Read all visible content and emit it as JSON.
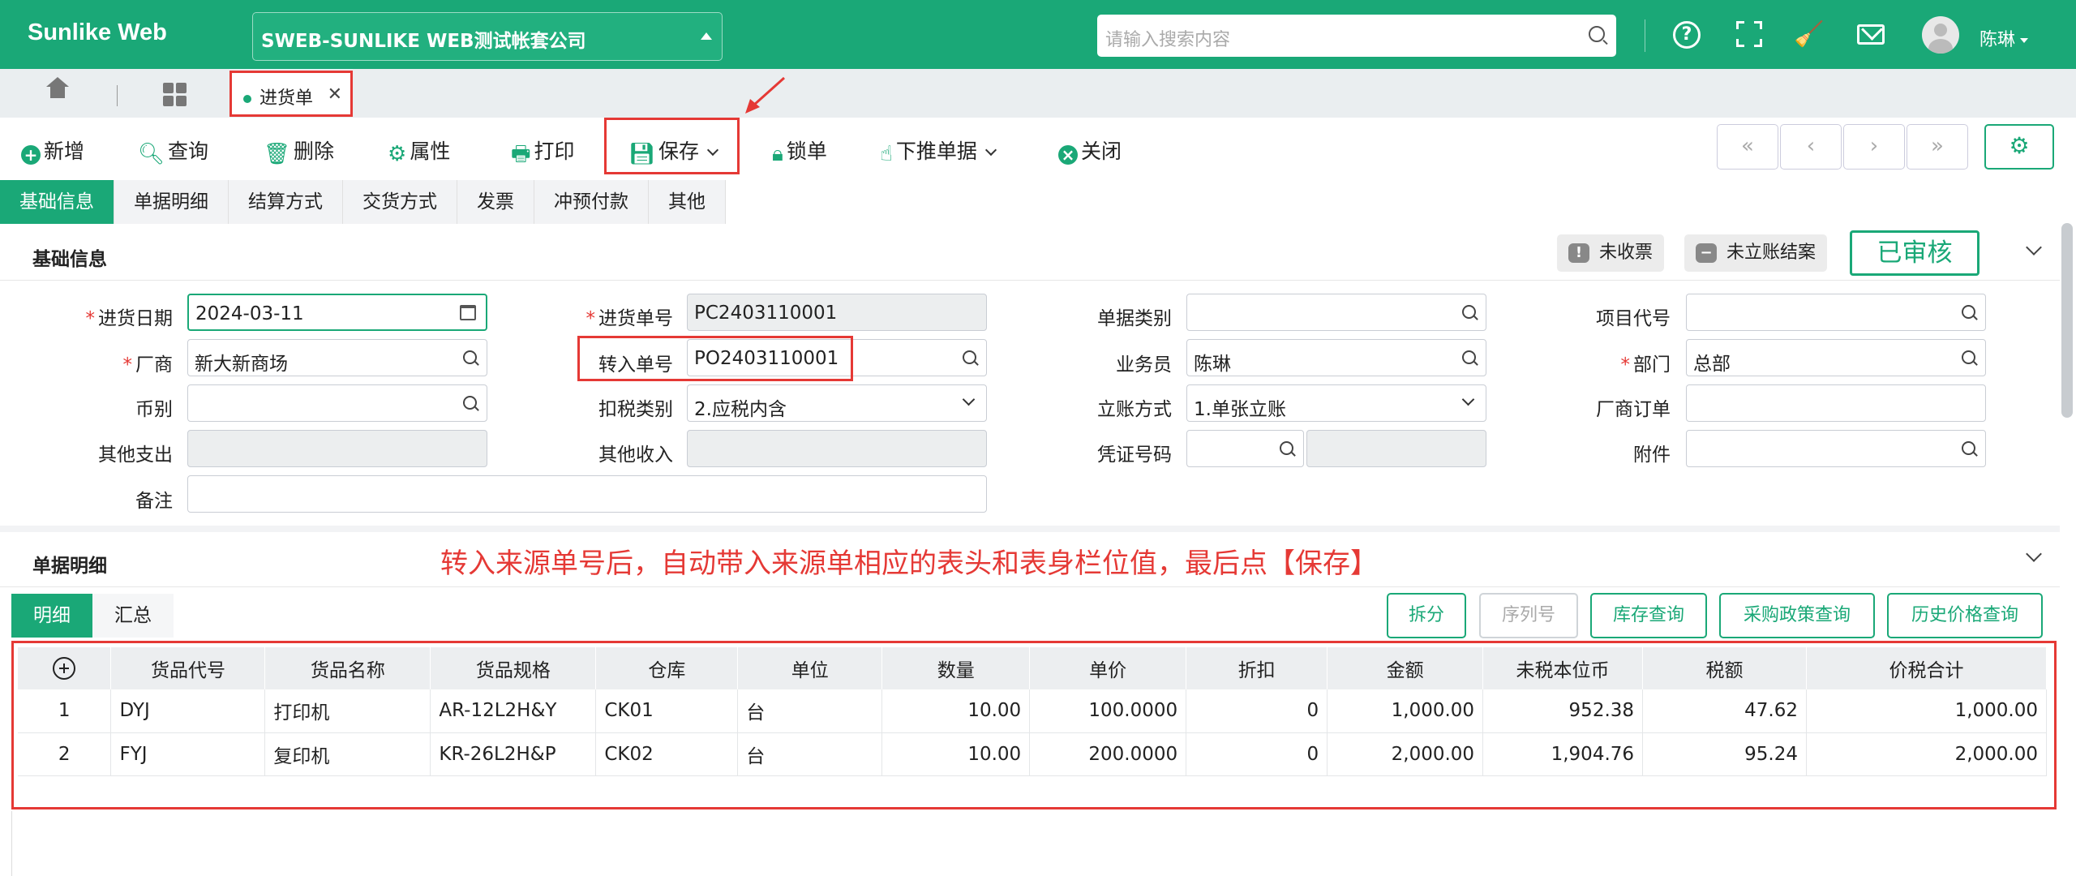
{
  "topbar": {
    "logo": "Sunlike Web",
    "company": "SWEB-SUNLIKE WEB测试帐套公司",
    "search_placeholder": "请输入搜索内容",
    "user": "陈琳",
    "colors": {
      "brand": "#1aa877",
      "alert": "#e53935"
    }
  },
  "tabs": {
    "doc_tab": "进货单"
  },
  "toolbar": {
    "new": "新增",
    "query": "查询",
    "delete": "删除",
    "props": "属性",
    "print": "打印",
    "save": "保存",
    "lock": "锁单",
    "push": "下推单据",
    "close": "关闭"
  },
  "subtabs": [
    "基础信息",
    "单据明细",
    "结算方式",
    "交货方式",
    "发票",
    "冲预付款",
    "其他"
  ],
  "basic": {
    "title": "基础信息",
    "badges": {
      "invoice": "未收票",
      "account": "未立账结案",
      "status": "已审核"
    }
  },
  "form": {
    "date_label": "进货日期",
    "date": "2024-03-11",
    "vendor_label": "厂商",
    "vendor": "新大新商场",
    "currency_label": "币别",
    "currency": "",
    "other_exp_label": "其他支出",
    "remark_label": "备注",
    "bill_no_label": "进货单号",
    "bill_no": "PC2403110001",
    "src_no_label": "转入单号",
    "src_no": "PO2403110001",
    "tax_label": "扣税类别",
    "tax": "2.应税内含",
    "other_inc_label": "其他收入",
    "bill_type_label": "单据类别",
    "bill_type": "",
    "clerk_label": "业务员",
    "clerk": "陈琳",
    "acct_label": "立账方式",
    "acct": "1.单张立账",
    "voucher_label": "凭证号码",
    "project_label": "项目代号",
    "dept_label": "部门",
    "dept": "总部",
    "vendor_order_label": "厂商订单",
    "attach_label": "附件"
  },
  "detail": {
    "title": "单据明细",
    "annotation": "转入来源单号后，自动带入来源单相应的表头和表身栏位值，最后点【保存】",
    "tabs": [
      "明细",
      "汇总"
    ],
    "buttons": {
      "split": "拆分",
      "serial": "序列号",
      "stock": "库存查询",
      "policy": "采购政策查询",
      "history": "历史价格查询"
    },
    "columns": [
      "货品代号",
      "货品名称",
      "货品规格",
      "仓库",
      "单位",
      "数量",
      "单价",
      "折扣",
      "金额",
      "未税本位币",
      "税额",
      "价税合计"
    ],
    "rows": [
      [
        "1",
        "DYJ",
        "打印机",
        "AR-12L2H&Y",
        "CK01",
        "台",
        "10.00",
        "100.0000",
        "0",
        "1,000.00",
        "952.38",
        "47.62",
        "1,000.00"
      ],
      [
        "2",
        "FYJ",
        "复印机",
        "KR-26L2H&P",
        "CK02",
        "台",
        "10.00",
        "200.0000",
        "0",
        "2,000.00",
        "1,904.76",
        "95.24",
        "2,000.00"
      ]
    ]
  }
}
